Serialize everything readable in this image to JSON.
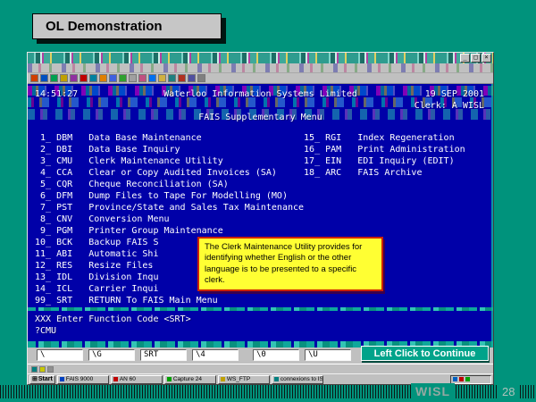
{
  "slide": {
    "title": "OL Demonstration",
    "brand": "WISL",
    "page": "28"
  },
  "window": {
    "controls": {
      "minimize": "_",
      "maximize": "□",
      "close": "×"
    }
  },
  "terminal": {
    "time": "14:51:27",
    "company": "Waterloo Information Systems Limited",
    "date": "19 SEP 2001",
    "clerk": "Clerk: A WISL",
    "menu_title": "FAIS Supplementary Menu",
    "menu_left": [
      {
        "num": "1",
        "code": "DBM",
        "desc": "Data Base Maintenance"
      },
      {
        "num": "2",
        "code": "DBI",
        "desc": "Data Base Inquiry"
      },
      {
        "num": "3",
        "code": "CMU",
        "desc": "Clerk Maintenance Utility"
      },
      {
        "num": "4",
        "code": "CCA",
        "desc": "Clear or Copy Audited Invoices (SA)"
      },
      {
        "num": "5",
        "code": "CQR",
        "desc": "Cheque Reconciliation (SA)"
      },
      {
        "num": "6",
        "code": "DFM",
        "desc": "Dump Files to Tape For Modelling (MO)"
      },
      {
        "num": "7",
        "code": "PST",
        "desc": "Province/State and Sales Tax Maintenance"
      },
      {
        "num": "8",
        "code": "CNV",
        "desc": "Conversion Menu"
      },
      {
        "num": "9",
        "code": "PGM",
        "desc": "Printer Group Maintenance"
      },
      {
        "num": "10",
        "code": "BCK",
        "desc": "Backup FAIS S"
      },
      {
        "num": "11",
        "code": "ABI",
        "desc": "Automatic Shi"
      },
      {
        "num": "12",
        "code": "RES",
        "desc": "Resize Files"
      },
      {
        "num": "13",
        "code": "IDL",
        "desc": "Division Inqu"
      },
      {
        "num": "14",
        "code": "ICL",
        "desc": "Carrier Inqui"
      },
      {
        "num": "99",
        "code": "SRT",
        "desc": "RETURN To FAIS Main Menu"
      }
    ],
    "menu_right": [
      {
        "num": "15",
        "code": "RGI",
        "desc": "Index Regeneration"
      },
      {
        "num": "16",
        "code": "PAM",
        "desc": "Print Administration"
      },
      {
        "num": "17",
        "code": "EIN",
        "desc": "EDI Inquiry (EDIT)"
      },
      {
        "num": "18",
        "code": "ARC",
        "desc": "FAIS Archive"
      }
    ],
    "prompt": "XXX Enter Function Code <SRT>",
    "entry": "?CMU",
    "tooltip": "The Clerk Maintenance Utility provides for identifying whether English or the other language is to be presented to a specific clerk."
  },
  "fkeys": [
    "\\",
    "\\G",
    "SRT",
    "\\4",
    "\\0",
    "\\U"
  ],
  "continue_button": "Left Click to Continue",
  "taskbar": {
    "start": "Start",
    "items": [
      "FAIS 9000",
      "AN 60",
      "Capture 24",
      "WS_FTP",
      "connexions to IS"
    ]
  },
  "colors": {
    "slide_bg": "#00937C",
    "terminal_bg": "#0000A8",
    "tooltip_bg": "#FFFF33",
    "tooltip_border": "#CC2200",
    "button_bg": "#00A38A"
  }
}
